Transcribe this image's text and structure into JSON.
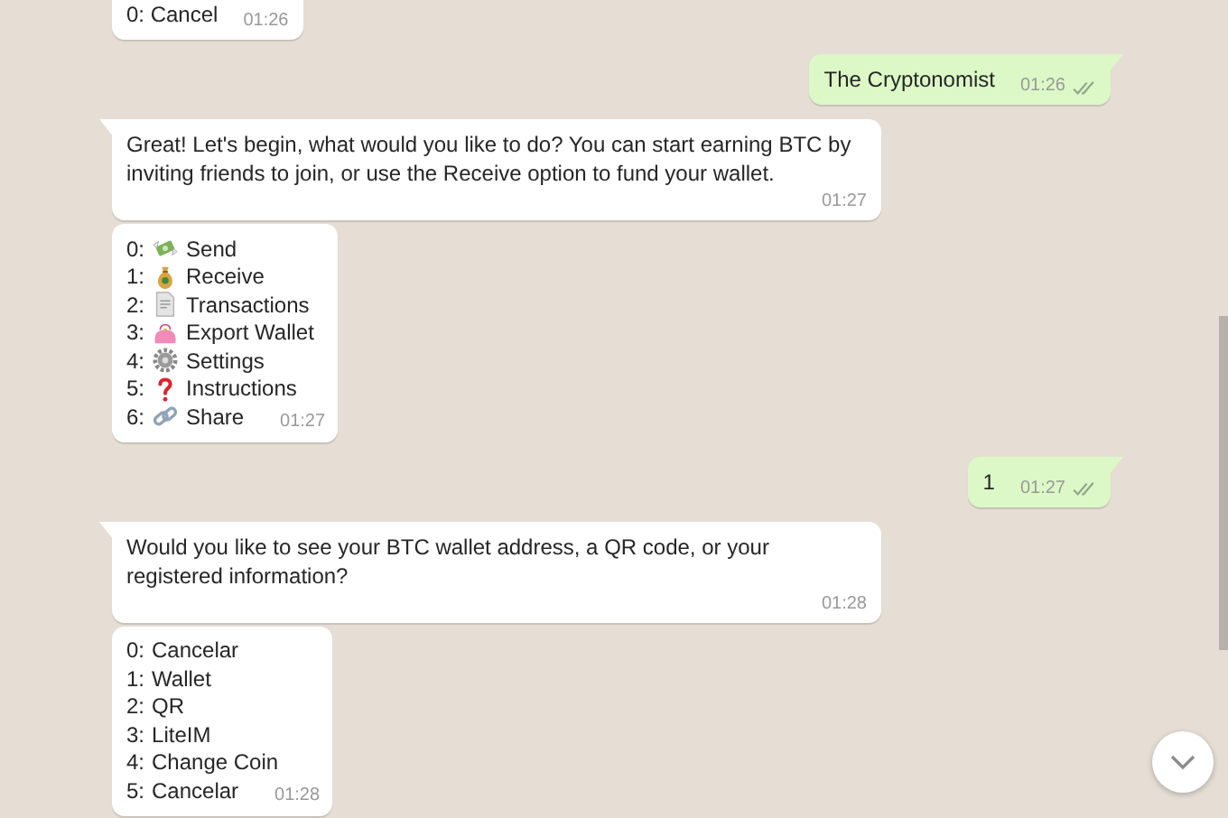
{
  "messages": [
    {
      "outgoing": false,
      "tail": false,
      "kind": "text",
      "text": "0: Cancel",
      "time": "01:26"
    },
    {
      "outgoing": true,
      "tail": true,
      "kind": "text",
      "text": "The Cryptonomist",
      "time": "01:26",
      "delivered": true
    },
    {
      "outgoing": false,
      "tail": true,
      "kind": "text",
      "text": "Great! Let's begin, what would you like to do? You can start earning BTC by inviting friends to join, or use the Receive option to fund your wallet.",
      "time": "01:27"
    },
    {
      "outgoing": false,
      "tail": false,
      "kind": "options",
      "time": "01:27",
      "options": [
        {
          "number": "0:",
          "kind": "money",
          "label": "Send"
        },
        {
          "number": "1:",
          "kind": "moneybag",
          "label": "Receive"
        },
        {
          "number": "2:",
          "kind": "document",
          "label": "Transactions"
        },
        {
          "number": "3:",
          "kind": "purse",
          "label": "Export Wallet"
        },
        {
          "number": "4:",
          "kind": "gear",
          "label": "Settings"
        },
        {
          "number": "5:",
          "kind": "question",
          "label": "Instructions"
        },
        {
          "number": "6:",
          "kind": "link",
          "label": "Share"
        }
      ]
    },
    {
      "outgoing": true,
      "tail": true,
      "kind": "text",
      "text": "1",
      "time": "01:27",
      "delivered": true
    },
    {
      "outgoing": false,
      "tail": true,
      "kind": "text",
      "text": "Would you like to see your BTC wallet address, a QR code, or your registered information?",
      "time": "01:28"
    },
    {
      "outgoing": false,
      "tail": false,
      "kind": "options",
      "time": "01:28",
      "options": [
        {
          "number": "0:",
          "label": "Cancelar"
        },
        {
          "number": "1:",
          "label": "Wallet"
        },
        {
          "number": "2:",
          "label": "QR"
        },
        {
          "number": "3:",
          "label": "LiteIM"
        },
        {
          "number": "4:",
          "label": "Change Coin"
        },
        {
          "number": "5:",
          "label": "Cancelar"
        }
      ]
    }
  ]
}
